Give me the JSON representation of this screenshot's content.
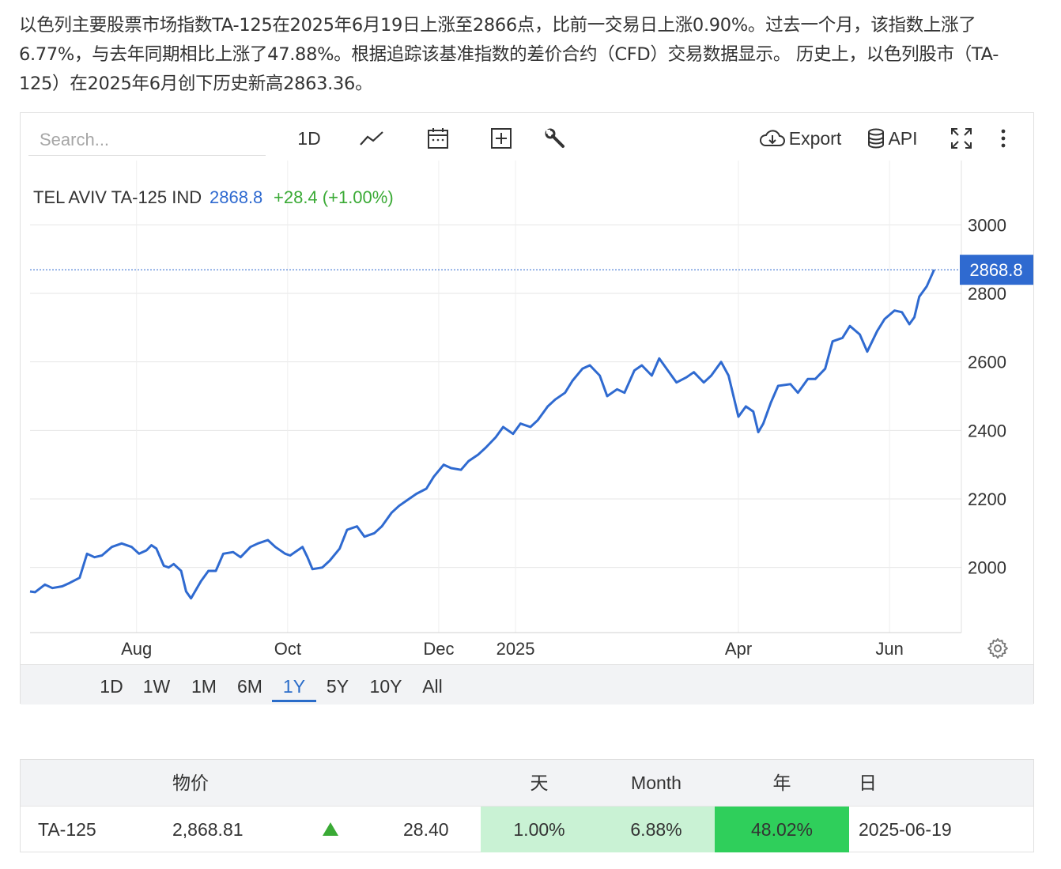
{
  "intro_text": "以色列主要股票市场指数TA-125在2025年6月19日上涨至2866点，比前一交易日上涨0.90%。过去一个月，该指数上涨了6.77%，与去年同期相比上涨了47.88%。根据追踪该基准指数的差价合约（CFD）交易数据显示。 历史上，以色列股市（TA-125）在2025年6月创下历史新高2863.36。",
  "toolbar": {
    "search_placeholder": "Search...",
    "interval_label": "1D",
    "export_label": "Export",
    "api_label": "API"
  },
  "legend": {
    "name": "TEL AVIV TA-125 IND",
    "value": "2868.8",
    "change": "+28.4 (+1.00%)"
  },
  "last_price_tag": "2868.8",
  "range_buttons": [
    "1D",
    "1W",
    "1M",
    "6M",
    "1Y",
    "5Y",
    "10Y",
    "All"
  ],
  "active_range": "1Y",
  "colors": {
    "line": "#2f6ad0",
    "positive": "#3aaa35",
    "price_tag": "#2f6ad0",
    "cell_light_green": "#c9f2d4",
    "cell_green": "#2fcf5b"
  },
  "chart_data": {
    "type": "line",
    "title": "",
    "xlabel": "",
    "ylabel": "",
    "ylim": [
      1810,
      3040
    ],
    "yticks": [
      2000,
      2200,
      2400,
      2600,
      2800,
      3000
    ],
    "x_tick_labels": [
      "Aug",
      "Oct",
      "Dec",
      "2025",
      "Apr",
      "Jun"
    ],
    "x_tick_dates": [
      "2024-08-01",
      "2024-10-01",
      "2024-12-01",
      "2025-01-01",
      "2025-04-01",
      "2025-06-01"
    ],
    "x_range": [
      "2024-06-19",
      "2025-06-30"
    ],
    "grid": true,
    "series": [
      {
        "name": "TEL AVIV TA-125 IND",
        "points": [
          [
            "2024-06-19",
            1930
          ],
          [
            "2024-06-21",
            1928
          ],
          [
            "2024-06-25",
            1950
          ],
          [
            "2024-06-28",
            1940
          ],
          [
            "2024-07-02",
            1945
          ],
          [
            "2024-07-05",
            1955
          ],
          [
            "2024-07-09",
            1970
          ],
          [
            "2024-07-12",
            2040
          ],
          [
            "2024-07-15",
            2030
          ],
          [
            "2024-07-18",
            2035
          ],
          [
            "2024-07-22",
            2060
          ],
          [
            "2024-07-26",
            2070
          ],
          [
            "2024-07-30",
            2060
          ],
          [
            "2024-08-02",
            2040
          ],
          [
            "2024-08-05",
            2050
          ],
          [
            "2024-08-07",
            2065
          ],
          [
            "2024-08-09",
            2055
          ],
          [
            "2024-08-12",
            2005
          ],
          [
            "2024-08-14",
            2000
          ],
          [
            "2024-08-16",
            2010
          ],
          [
            "2024-08-19",
            1990
          ],
          [
            "2024-08-21",
            1930
          ],
          [
            "2024-08-23",
            1910
          ],
          [
            "2024-08-27",
            1960
          ],
          [
            "2024-08-30",
            1990
          ],
          [
            "2024-09-02",
            1990
          ],
          [
            "2024-09-05",
            2040
          ],
          [
            "2024-09-09",
            2045
          ],
          [
            "2024-09-12",
            2030
          ],
          [
            "2024-09-16",
            2060
          ],
          [
            "2024-09-19",
            2070
          ],
          [
            "2024-09-23",
            2080
          ],
          [
            "2024-09-26",
            2060
          ],
          [
            "2024-09-30",
            2040
          ],
          [
            "2024-10-02",
            2035
          ],
          [
            "2024-10-04",
            2045
          ],
          [
            "2024-10-07",
            2060
          ],
          [
            "2024-10-09",
            2030
          ],
          [
            "2024-10-11",
            1995
          ],
          [
            "2024-10-15",
            2000
          ],
          [
            "2024-10-18",
            2020
          ],
          [
            "2024-10-22",
            2055
          ],
          [
            "2024-10-25",
            2110
          ],
          [
            "2024-10-29",
            2120
          ],
          [
            "2024-11-01",
            2090
          ],
          [
            "2024-11-05",
            2100
          ],
          [
            "2024-11-08",
            2120
          ],
          [
            "2024-11-12",
            2160
          ],
          [
            "2024-11-15",
            2180
          ],
          [
            "2024-11-19",
            2200
          ],
          [
            "2024-11-22",
            2215
          ],
          [
            "2024-11-26",
            2230
          ],
          [
            "2024-11-29",
            2265
          ],
          [
            "2024-12-03",
            2300
          ],
          [
            "2024-12-06",
            2290
          ],
          [
            "2024-12-10",
            2285
          ],
          [
            "2024-12-13",
            2310
          ],
          [
            "2024-12-17",
            2330
          ],
          [
            "2024-12-20",
            2350
          ],
          [
            "2024-12-24",
            2380
          ],
          [
            "2024-12-27",
            2410
          ],
          [
            "2024-12-31",
            2390
          ],
          [
            "2025-01-03",
            2420
          ],
          [
            "2025-01-07",
            2410
          ],
          [
            "2025-01-10",
            2430
          ],
          [
            "2025-01-14",
            2470
          ],
          [
            "2025-01-17",
            2490
          ],
          [
            "2025-01-21",
            2510
          ],
          [
            "2025-01-24",
            2545
          ],
          [
            "2025-01-28",
            2580
          ],
          [
            "2025-01-31",
            2590
          ],
          [
            "2025-02-04",
            2560
          ],
          [
            "2025-02-07",
            2500
          ],
          [
            "2025-02-11",
            2520
          ],
          [
            "2025-02-14",
            2510
          ],
          [
            "2025-02-18",
            2575
          ],
          [
            "2025-02-21",
            2590
          ],
          [
            "2025-02-25",
            2560
          ],
          [
            "2025-02-28",
            2610
          ],
          [
            "2025-03-04",
            2570
          ],
          [
            "2025-03-07",
            2540
          ],
          [
            "2025-03-11",
            2555
          ],
          [
            "2025-03-14",
            2570
          ],
          [
            "2025-03-18",
            2540
          ],
          [
            "2025-03-21",
            2560
          ],
          [
            "2025-03-25",
            2600
          ],
          [
            "2025-03-28",
            2560
          ],
          [
            "2025-04-01",
            2440
          ],
          [
            "2025-04-04",
            2470
          ],
          [
            "2025-04-07",
            2455
          ],
          [
            "2025-04-09",
            2395
          ],
          [
            "2025-04-11",
            2420
          ],
          [
            "2025-04-14",
            2480
          ],
          [
            "2025-04-17",
            2530
          ],
          [
            "2025-04-22",
            2535
          ],
          [
            "2025-04-25",
            2510
          ],
          [
            "2025-04-29",
            2550
          ],
          [
            "2025-05-02",
            2550
          ],
          [
            "2025-05-06",
            2580
          ],
          [
            "2025-05-09",
            2660
          ],
          [
            "2025-05-13",
            2670
          ],
          [
            "2025-05-16",
            2705
          ],
          [
            "2025-05-20",
            2680
          ],
          [
            "2025-05-23",
            2630
          ],
          [
            "2025-05-27",
            2690
          ],
          [
            "2025-05-30",
            2725
          ],
          [
            "2025-06-03",
            2750
          ],
          [
            "2025-06-06",
            2745
          ],
          [
            "2025-06-09",
            2710
          ],
          [
            "2025-06-11",
            2730
          ],
          [
            "2025-06-13",
            2790
          ],
          [
            "2025-06-16",
            2820
          ],
          [
            "2025-06-19",
            2868.8
          ]
        ]
      }
    ]
  },
  "table": {
    "headers": {
      "name": "物价",
      "day": "天",
      "month": "Month",
      "year": "年",
      "date": "日"
    },
    "row": {
      "symbol": "TA-125",
      "price": "2,868.81",
      "change": "28.40",
      "day_pct": "1.00%",
      "month_pct": "6.88%",
      "year_pct": "48.02%",
      "date": "2025-06-19"
    }
  }
}
